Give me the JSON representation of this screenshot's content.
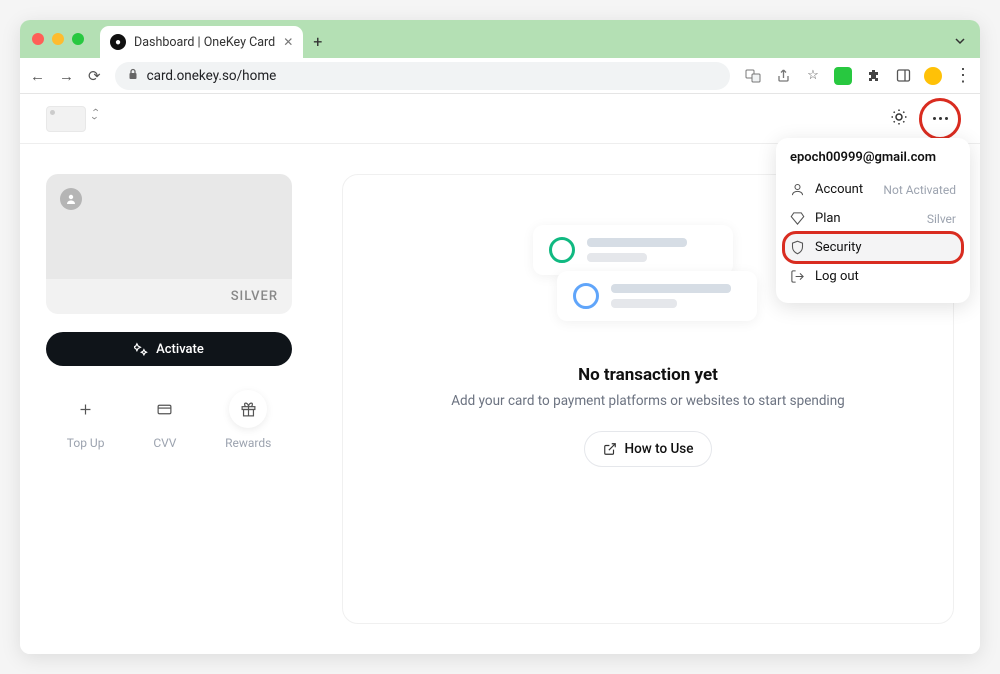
{
  "browser": {
    "tab_title": "Dashboard | OneKey Card",
    "url": "card.onekey.so/home"
  },
  "card": {
    "tier": "SILVER"
  },
  "activate_label": "Activate",
  "quick_actions": {
    "topup": "Top Up",
    "cvv": "CVV",
    "rewards": "Rewards"
  },
  "empty": {
    "title": "No transaction yet",
    "desc": "Add your card to payment platforms or websites to start spending",
    "howto": "How to Use"
  },
  "dropdown": {
    "email": "epoch00999@gmail.com",
    "account_label": "Account",
    "account_status": "Not Activated",
    "plan_label": "Plan",
    "plan_value": "Silver",
    "security_label": "Security",
    "logout_label": "Log out"
  }
}
